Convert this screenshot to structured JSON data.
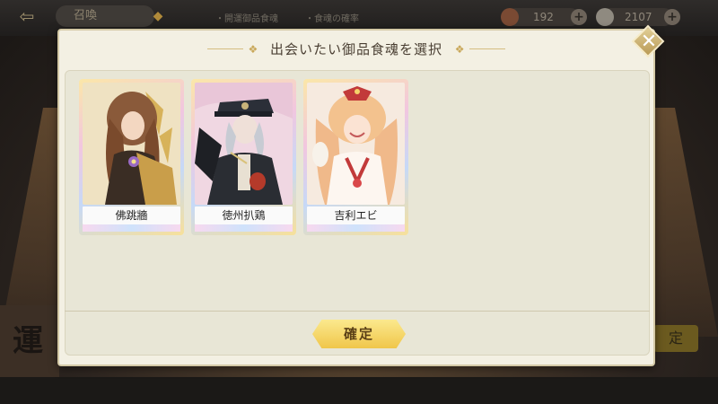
{
  "background": {
    "top_tab": "召喚",
    "info_1": "・開運御品食魂",
    "info_2": "・食魂の確率",
    "currency_1": "192",
    "currency_2": "2107",
    "side_left_char": "運",
    "side_right_char": "定"
  },
  "modal": {
    "title": "出会いたい御品食魂を選択",
    "close_symbol": "✕",
    "confirm_label": "確定",
    "cards": [
      {
        "name": "佛跳牆"
      },
      {
        "name": "徳州扒鶏"
      },
      {
        "name": "吉利エビ"
      }
    ]
  },
  "colors": {
    "accent_gold": "#f0c64a",
    "panel_bg": "#f3f0e3",
    "inner_bg": "#e8e6d6"
  }
}
